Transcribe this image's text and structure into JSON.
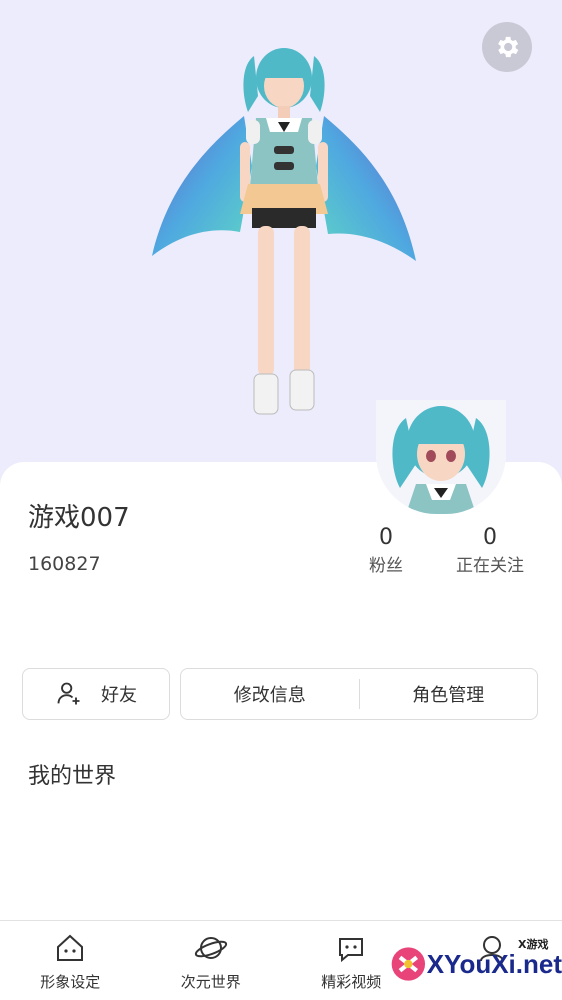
{
  "profile": {
    "username": "游戏007",
    "user_id": "160827",
    "fans_count": "0",
    "fans_label": "粉丝",
    "following_count": "0",
    "following_label": "正在关注"
  },
  "actions": {
    "friends_label": "好友",
    "edit_info_label": "修改信息",
    "role_manage_label": "角色管理"
  },
  "section": {
    "my_world_title": "我的世界"
  },
  "bottom_nav": {
    "items": [
      {
        "label": "形象设定",
        "icon": "house-face-icon"
      },
      {
        "label": "次元世界",
        "icon": "planet-icon"
      },
      {
        "label": "精彩视频",
        "icon": "chat-bubble-icon"
      },
      {
        "label": "",
        "icon": "avatar-nav-icon"
      }
    ]
  },
  "watermark": {
    "text": "XYouXi.net",
    "small_text": "X游戏"
  },
  "colors": {
    "hero_background": "#ececfc",
    "sheet_background": "#ffffff",
    "character_hair": "#4fb9c8",
    "cape_gradient_start": "#6a5fc8",
    "cape_gradient_end": "#5fd6c4"
  }
}
